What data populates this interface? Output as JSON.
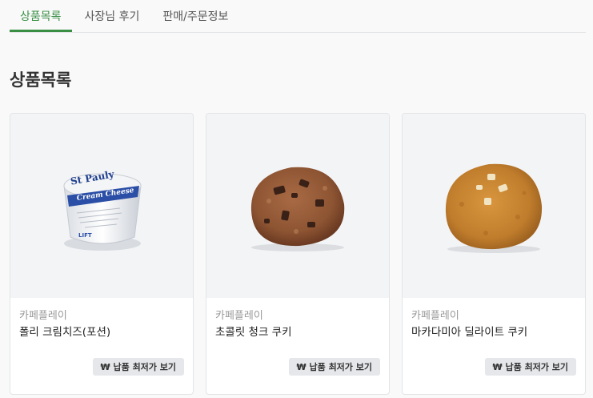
{
  "tabs": [
    {
      "label": "상품목록",
      "active": true
    },
    {
      "label": "사장님 후기",
      "active": false
    },
    {
      "label": "판매/주문정보",
      "active": false
    }
  ],
  "page_title": "상품목록",
  "products": [
    {
      "image": "cream-cheese-cup-image",
      "brand": "카페플레이",
      "name": "폴리 크림치즈(포션)",
      "button": "₩ 납품 최저가 보기"
    },
    {
      "image": "chocolate-chunk-cookie-image",
      "brand": "카페플레이",
      "name": "초콜릿 청크 쿠키",
      "button": "₩ 납품 최저가 보기"
    },
    {
      "image": "macadamia-cookie-image",
      "brand": "카페플레이",
      "name": "마카다미아 딜라이트 쿠키",
      "button": "₩ 납품 최저가 보기"
    }
  ],
  "colors": {
    "accent": "#3a8f45"
  },
  "package_text": {
    "logo": "St Pauly",
    "label": "Cream Cheese",
    "badge": "LIFT"
  }
}
